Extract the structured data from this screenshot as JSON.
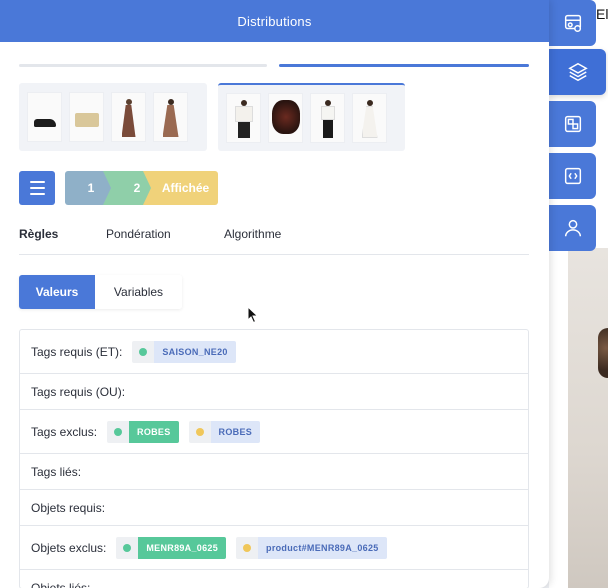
{
  "background": {
    "top_text": "El",
    "side_buttons": [
      {
        "icon": "pipeline-icon",
        "active": false
      },
      {
        "icon": "layers-icon",
        "active": true
      },
      {
        "icon": "ab-test-icon",
        "active": false
      },
      {
        "icon": "code-icon",
        "active": false
      },
      {
        "icon": "user-icon",
        "active": false
      }
    ]
  },
  "panel": {
    "title": "Distributions",
    "progress": {
      "step": 2,
      "total": 2
    }
  },
  "steps": {
    "items": [
      "1",
      "2",
      "Affichée"
    ]
  },
  "tabs": [
    "Règles",
    "Pondération",
    "Algorithme"
  ],
  "segmented": {
    "on": "Valeurs",
    "off": "Variables"
  },
  "rules": [
    {
      "label": "Tags requis (ET):",
      "chips": [
        {
          "dot": "#57c89a",
          "text": "SAISON_NE20",
          "style": "blue"
        }
      ]
    },
    {
      "label": "Tags requis (OU):",
      "chips": []
    },
    {
      "label": "Tags exclus:",
      "chips": [
        {
          "dot": "#57c89a",
          "text": "ROBES",
          "style": "green"
        },
        {
          "dot": "#f0c75a",
          "text": "ROBES",
          "style": "blue2"
        }
      ]
    },
    {
      "label": "Tags liés:",
      "chips": []
    },
    {
      "label": "Objets requis:",
      "chips": []
    },
    {
      "label": "Objets exclus:",
      "chips": [
        {
          "dot": "#57c89a",
          "text": "MENR89A_0625",
          "style": "green"
        },
        {
          "dot": "#f0c75a",
          "text": "product#MENR89A_0625",
          "style": "blue2"
        }
      ]
    },
    {
      "label": "Objets liés:",
      "chips": []
    }
  ],
  "colors": {
    "accent": "#4a78d8",
    "step1": "#8fb0c8",
    "step2": "#8fcfa9",
    "step3": "#f0d27a"
  }
}
